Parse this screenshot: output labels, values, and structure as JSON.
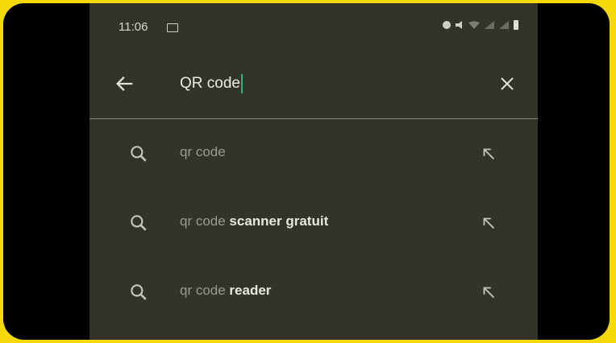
{
  "status": {
    "time": "11:06",
    "icons": [
      "message-icon",
      "alarm-icon",
      "mute-icon",
      "wifi-icon",
      "signal-icon",
      "battery-icon"
    ]
  },
  "search": {
    "query": "QR code"
  },
  "suggestions": [
    {
      "prefix": "qr code",
      "completion": ""
    },
    {
      "prefix": "qr code",
      "completion": " scanner gratuit"
    },
    {
      "prefix": "qr code",
      "completion": " reader"
    }
  ],
  "colors": {
    "frame": "#f5d90a",
    "background": "#33332a",
    "caret": "#2db27a"
  }
}
